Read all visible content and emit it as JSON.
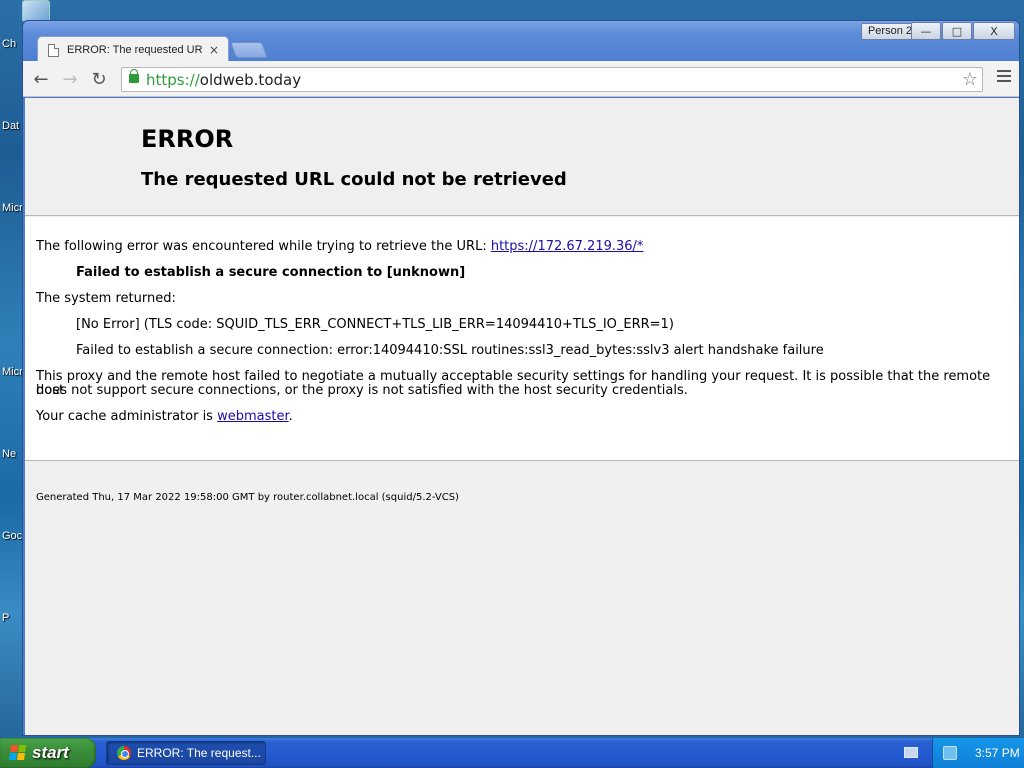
{
  "desktop": {
    "icon_labels": [
      "Ch",
      "Dat",
      "Micr",
      "Micr",
      "Ne",
      "Goc",
      "P"
    ]
  },
  "window": {
    "profile_button": "Person 2",
    "minimize_glyph": "—",
    "maximize_glyph": "□",
    "close_glyph": "X"
  },
  "tab": {
    "title": "ERROR: The requested URL",
    "close_glyph": "×"
  },
  "toolbar": {
    "back_glyph": "←",
    "forward_glyph": "→",
    "reload_glyph": "↻",
    "url_scheme": "https://",
    "url_host": "oldweb.today",
    "star_glyph": "☆"
  },
  "page": {
    "title": "ERROR",
    "subtitle": "The requested URL could not be retrieved",
    "intro_text": "The following error was encountered while trying to retrieve the URL: ",
    "intro_link": "https://172.67.219.36/*",
    "error_message": "Failed to establish a secure connection to [unknown]",
    "system_returned": "The system returned:",
    "tls_code": "[No Error] (TLS code: SQUID_TLS_ERR_CONNECT+TLS_LIB_ERR=14094410+TLS_IO_ERR=1)",
    "ssl_error": "Failed to establish a secure connection: error:14094410:SSL routines:ssl3_read_bytes:sslv3 alert handshake failure",
    "explanation_line1": "This proxy and the remote host failed to negotiate a mutually acceptable security settings for handling your request. It is possible that the remote host",
    "explanation_line2": "does not support secure connections, or the proxy is not satisfied with the host security credentials.",
    "admin_prefix": "Your cache administrator is ",
    "admin_link": "webmaster",
    "admin_suffix": ".",
    "footer": "Generated Thu, 17 Mar 2022 19:58:00 GMT by router.collabnet.local (squid/5.2-VCS)"
  },
  "taskbar": {
    "start_label": "start",
    "task_label": "ERROR: The request...",
    "clock": "3:57 PM"
  },
  "colors": {
    "link": "#1a0dab",
    "secure_green": "#2e9b3a",
    "taskbar_blue": "#245bd0",
    "start_green": "#3b8f3b"
  },
  "icons": [
    "page-icon",
    "lock-icon",
    "star-icon",
    "menu-icon",
    "windows-flag-icon",
    "chrome-icon",
    "keyboard-icon",
    "network-icon"
  ]
}
